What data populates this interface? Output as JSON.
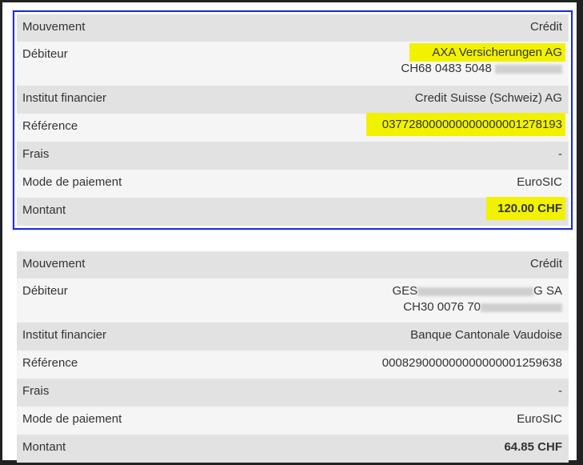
{
  "transactions": [
    {
      "selected": true,
      "mouvement": {
        "label": "Mouvement",
        "value": "Crédit"
      },
      "debiteur": {
        "label": "Débiteur",
        "name": "AXA Versicherungen AG",
        "iban_visible": "CH68 0483 5048"
      },
      "institut": {
        "label": "Institut financier",
        "value": "Credit Suisse (Schweiz) AG"
      },
      "reference": {
        "label": "Référence",
        "value": "037728000000000000001278193"
      },
      "frais": {
        "label": "Frais",
        "value": "-"
      },
      "mode": {
        "label": "Mode de paiement",
        "value": "EuroSIC"
      },
      "montant": {
        "label": "Montant",
        "value": "120.00 CHF"
      }
    },
    {
      "selected": false,
      "mouvement": {
        "label": "Mouvement",
        "value": "Crédit"
      },
      "debiteur": {
        "label": "Débiteur",
        "name_prefix": "GES",
        "name_suffix": "G SA",
        "iban_visible": "CH30 0076 70"
      },
      "institut": {
        "label": "Institut financier",
        "value": "Banque Cantonale Vaudoise"
      },
      "reference": {
        "label": "Référence",
        "value": "000829000000000000001259638"
      },
      "frais": {
        "label": "Frais",
        "value": "-"
      },
      "mode": {
        "label": "Mode de paiement",
        "value": "EuroSIC"
      },
      "montant": {
        "label": "Montant",
        "value": "64.85 CHF"
      }
    }
  ],
  "colors": {
    "highlight": "#f2f200",
    "selection": "#1a2fd6",
    "row_dark": "#e2e2e2",
    "row_light": "#f5f5f5"
  }
}
